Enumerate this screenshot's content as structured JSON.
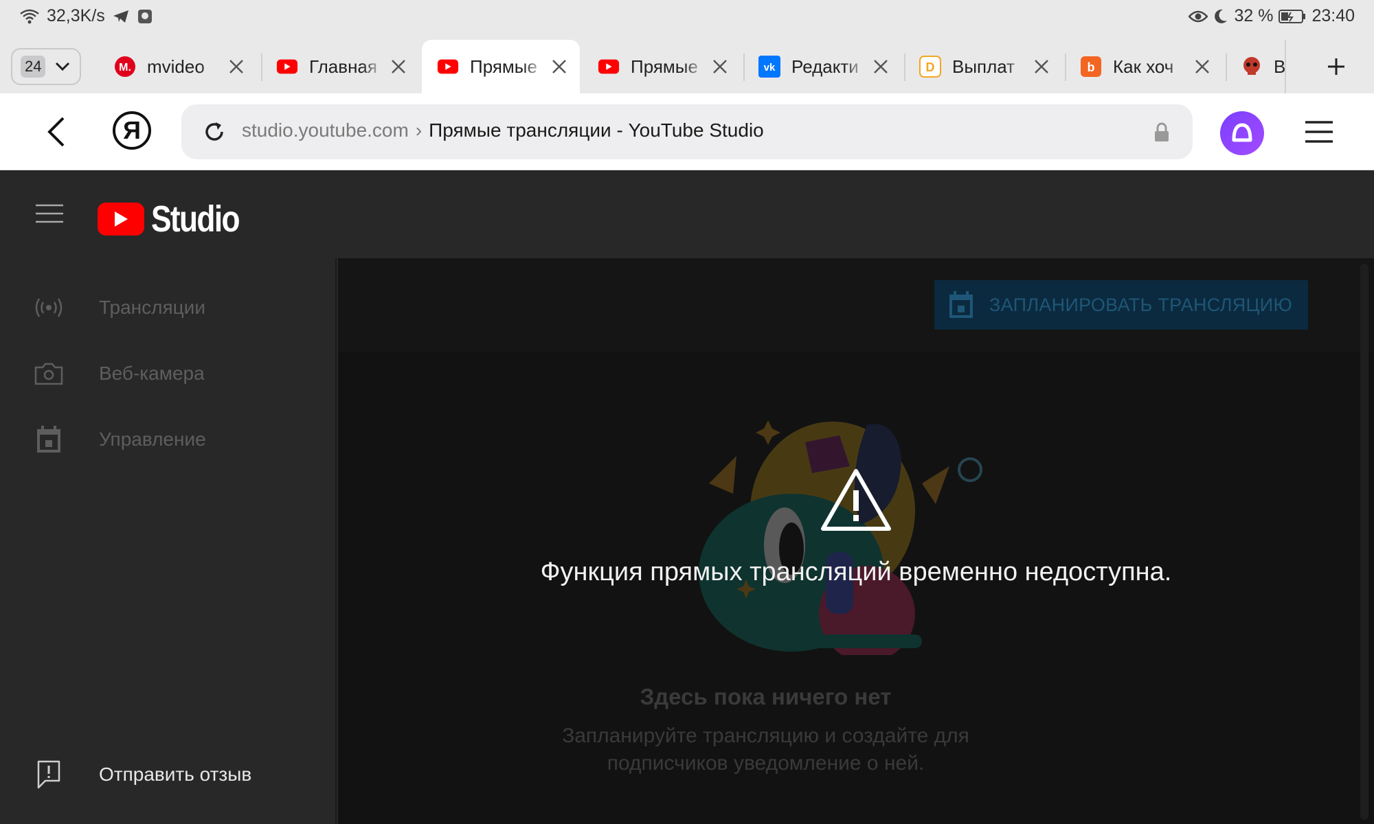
{
  "status_bar": {
    "net_speed": "32,3K/s",
    "battery": "32 %",
    "time": "23:40",
    "icons": [
      "wifi-icon",
      "telegram-icon",
      "notification-icon",
      "eye-icon",
      "moon-icon",
      "battery-icon"
    ]
  },
  "tab_strip": {
    "tab_count": "24",
    "tabs": [
      {
        "title": "mvideo",
        "favicon": "mvideo-favicon",
        "color": "#e0001b"
      },
      {
        "title": "Главная",
        "favicon": "youtube-favicon",
        "color": "#ff0000"
      },
      {
        "title": "Прямые",
        "favicon": "youtube-favicon",
        "color": "#ff0000",
        "active": true
      },
      {
        "title": "Прямые",
        "favicon": "youtube-favicon",
        "color": "#ff0000"
      },
      {
        "title": "Редакти",
        "favicon": "vk-favicon",
        "color": "#0077ff"
      },
      {
        "title": "Выплат",
        "favicon": "donationalerts-favicon",
        "color": "#f5a623"
      },
      {
        "title": "Как хоч",
        "favicon": "orange-favicon",
        "color": "#f26522"
      },
      {
        "title": "В",
        "favicon": "skull-favicon",
        "color": "#c0392b"
      }
    ],
    "new_tab_label": "+"
  },
  "address_bar": {
    "yandex_letter": "Я",
    "domain": "studio.youtube.com",
    "separator": "›",
    "page_title": "Прямые трансляции - YouTube Studio"
  },
  "studio": {
    "logo_text": "Studio",
    "sidebar": {
      "items": [
        {
          "label": "Трансляции",
          "icon": "broadcast-icon"
        },
        {
          "label": "Веб-камера",
          "icon": "camera-icon"
        },
        {
          "label": "Управление",
          "icon": "calendar-icon"
        }
      ],
      "feedback_label": "Отправить отзыв"
    },
    "main": {
      "schedule_button": "ЗАПЛАНИРОВАТЬ ТРАНСЛЯЦИЮ",
      "warning_text": "Функция прямых трансляций временно недоступна.",
      "empty_title": "Здесь пока ничего нет",
      "empty_subtitle_line1": "Запланируйте трансляцию и создайте для",
      "empty_subtitle_line2": "подписчиков уведомление о ней."
    }
  },
  "colors": {
    "accent_blue": "#3ea6ff",
    "youtube_red": "#ff0000",
    "alice_purple": "#8a3ffc"
  }
}
